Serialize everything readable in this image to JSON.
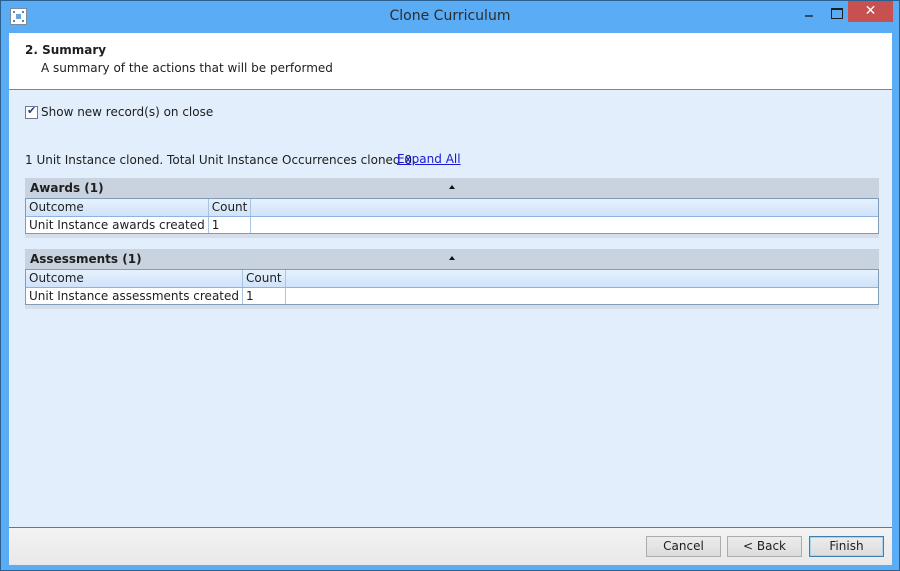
{
  "window": {
    "title": "Clone Curriculum",
    "controls": {
      "minimize": "minimize",
      "maximize": "maximize",
      "close": "✕"
    }
  },
  "header": {
    "step_title": "2. Summary",
    "step_description": "A summary of the actions that will be performed"
  },
  "options": {
    "show_new_records_label": "Show new record(s) on close",
    "show_new_records_checked": true
  },
  "summary": {
    "text": "1 Unit Instance cloned. Total Unit Instance Occurrences cloned 0.",
    "expand_all_label": "Expand All"
  },
  "groups": [
    {
      "title": "Awards (1)",
      "columns": [
        "Outcome",
        "Count"
      ],
      "rows": [
        {
          "outcome": "Unit Instance awards created",
          "count": "1"
        }
      ]
    },
    {
      "title": "Assessments (1)",
      "columns": [
        "Outcome",
        "Count"
      ],
      "rows": [
        {
          "outcome": "Unit Instance assessments created",
          "count": "1"
        }
      ]
    }
  ],
  "footer": {
    "cancel_label": "Cancel",
    "back_label": "< Back",
    "finish_label": "Finish"
  },
  "colors": {
    "titlebar": "#5aacf5",
    "close_button": "#c75050",
    "content_bg": "#e2eefb",
    "group_header": "#c9d3e0",
    "link": "#1a1ad6"
  }
}
